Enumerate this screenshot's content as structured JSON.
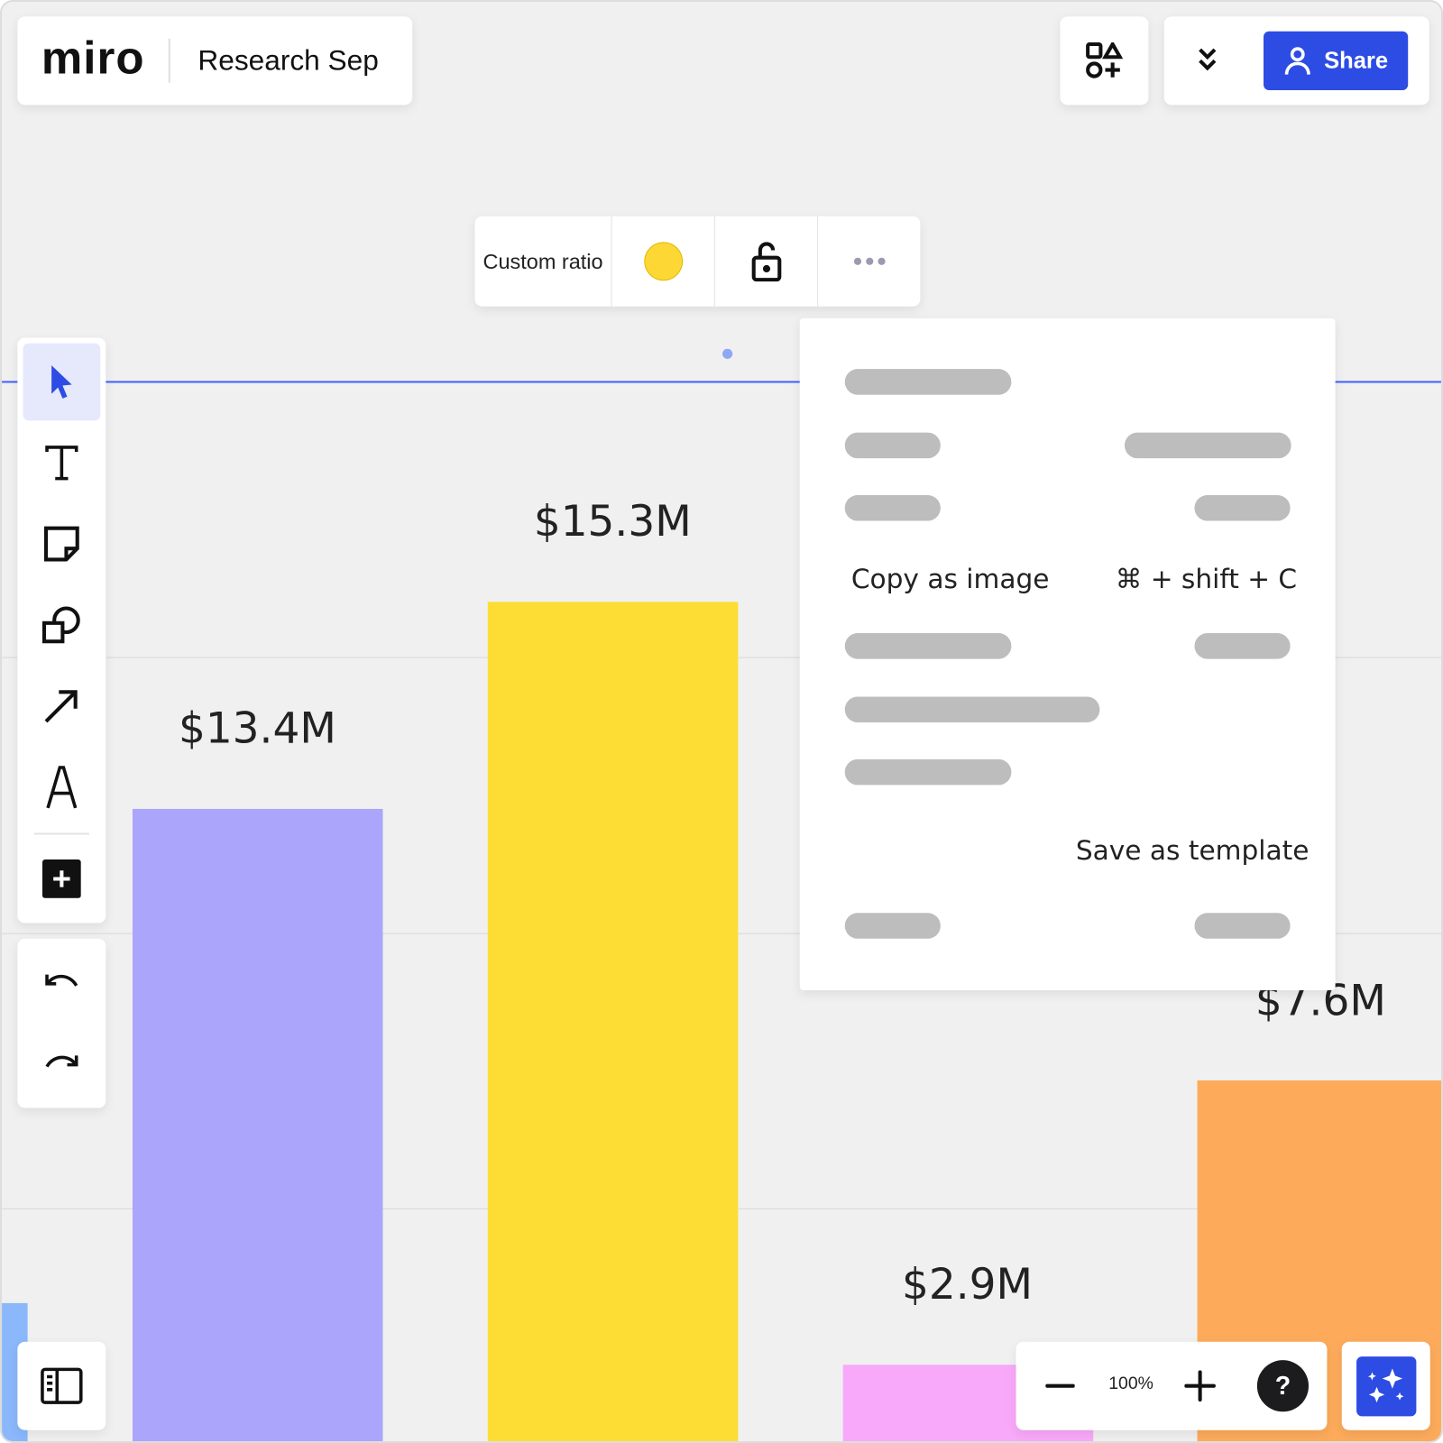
{
  "header": {
    "logo": "miro",
    "board_title": "Research Sep",
    "share_label": "Share"
  },
  "context_toolbar": {
    "ratio_label": "Custom ratio",
    "color": "#FDD835"
  },
  "chart_bars": [
    {
      "label": "$13.4M",
      "color": "#ABA5FB"
    },
    {
      "label": "$15.3M",
      "color": "#FDDD34"
    },
    {
      "label": "$2.9M",
      "color": "#F8A9F9"
    },
    {
      "label": "$7.6M",
      "color": "#FDAB5B"
    }
  ],
  "context_menu": {
    "copy_as_image": "Copy as image",
    "copy_shortcut": "⌘ + shift + C",
    "save_as_template": "Save as template"
  },
  "zoom": {
    "level": "100%"
  },
  "colors": {
    "accent": "#2D4CE4",
    "selection": "#4262FF"
  }
}
